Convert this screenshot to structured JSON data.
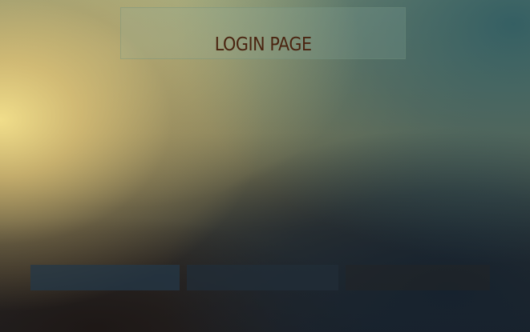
{
  "page": {
    "title": "LOGIN PAGE"
  },
  "colors": {
    "title_text": "#4a2410",
    "background_warm": "#f0dc8a",
    "background_cool": "#305c62",
    "background_dark": "#16222e"
  },
  "footer": {
    "tabs": [
      {
        "label": ""
      },
      {
        "label": ""
      },
      {
        "label": ""
      }
    ]
  }
}
